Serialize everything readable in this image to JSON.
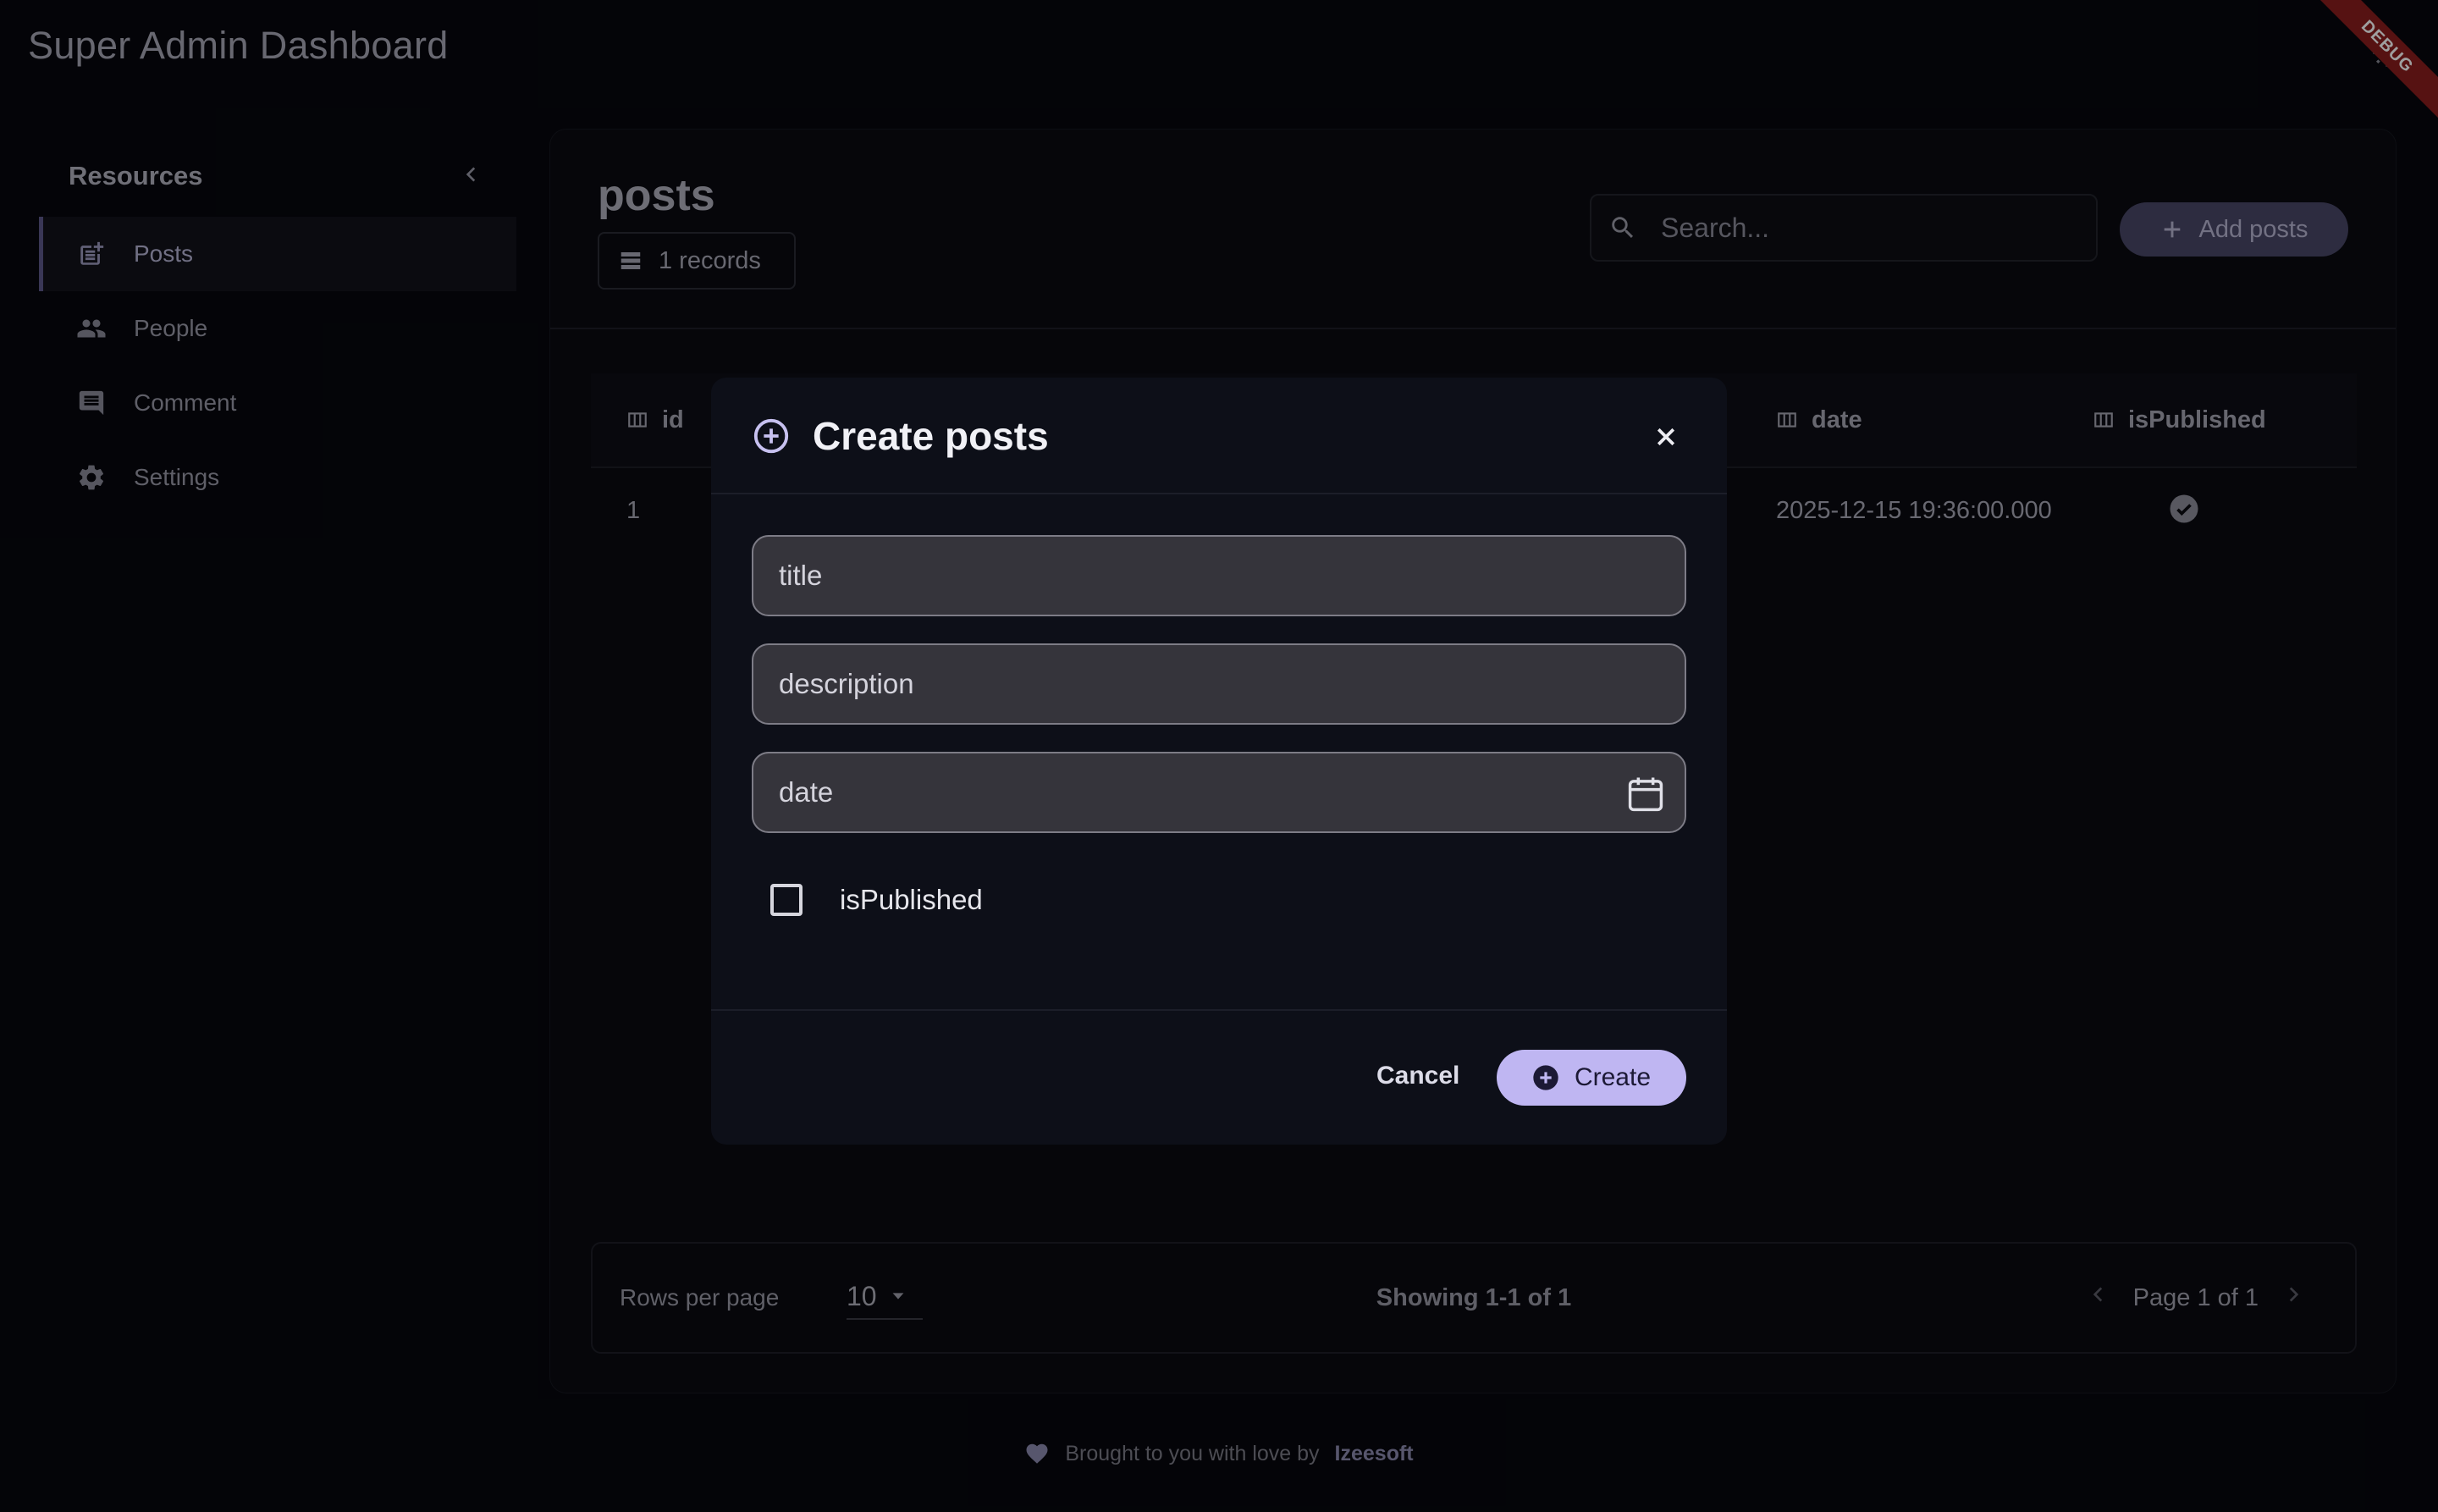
{
  "app": {
    "title": "Super Admin Dashboard",
    "debug_banner": "DEBUG"
  },
  "sidebar": {
    "title": "Resources",
    "items": [
      {
        "label": "Posts",
        "icon": "post-add-icon",
        "active": true
      },
      {
        "label": "People",
        "icon": "people-icon",
        "active": false
      },
      {
        "label": "Comment",
        "icon": "comment-icon",
        "active": false
      },
      {
        "label": "Settings",
        "icon": "gear-icon",
        "active": false
      }
    ]
  },
  "main": {
    "page_title": "posts",
    "records": "1 records",
    "search": {
      "placeholder": "Search..."
    },
    "add_button": "Add posts"
  },
  "table": {
    "columns": [
      "id",
      "date",
      "isPublished"
    ],
    "rows": [
      {
        "id": "1",
        "date": "2025-12-15 19:36:00.000",
        "isPublished": true
      }
    ]
  },
  "pagination": {
    "rows_per_page_label": "Rows per page",
    "rows_per_page_value": "10",
    "showing": "Showing 1-1 of 1",
    "page": "Page 1 of 1"
  },
  "footer": {
    "text": "Brought to you with love by",
    "brand": "Izeesoft"
  },
  "dialog": {
    "title": "Create posts",
    "fields": {
      "title": "title",
      "description": "description",
      "date": "date"
    },
    "checkbox_label": "isPublished",
    "checkbox_checked": false,
    "cancel": "Cancel",
    "create": "Create"
  },
  "colors": {
    "background": "#07080d",
    "accent": "#bfb6f2",
    "add_button": "#4a4768",
    "debug_ribbon": "#8c1d1d"
  }
}
